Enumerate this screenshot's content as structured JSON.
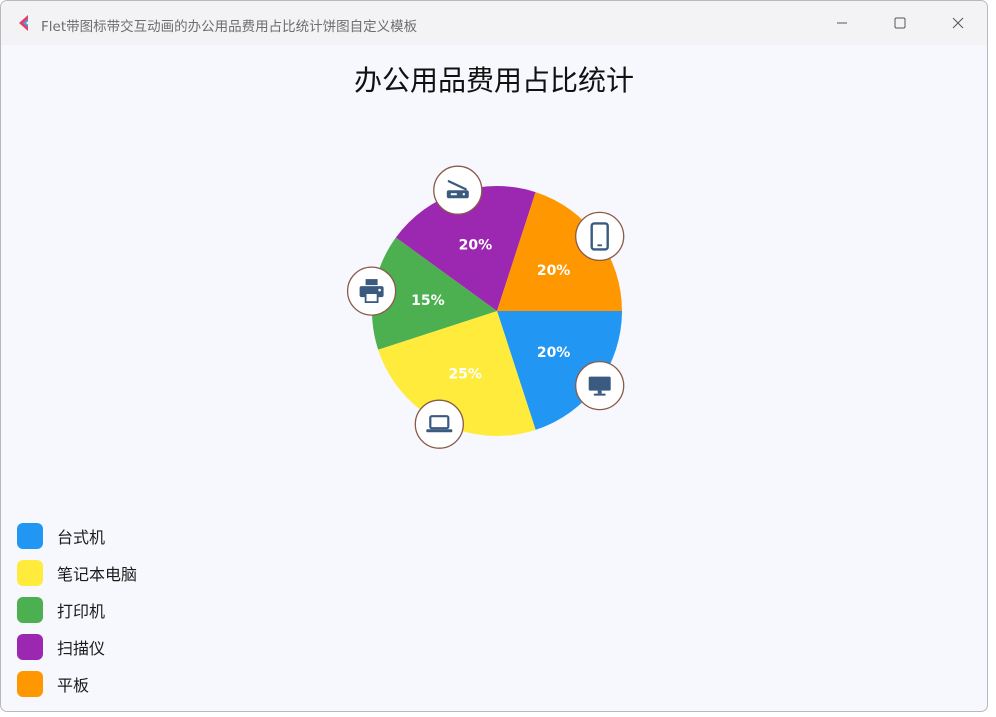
{
  "window": {
    "title": "Flet带图标带交互动画的办公用品费用占比统计饼图自定义模板"
  },
  "chart_data": {
    "type": "pie",
    "title": "办公用品费用占比统计",
    "slices": [
      {
        "name": "台式机",
        "value": 20,
        "label": "20%",
        "color": "#2196f3",
        "icon": "desktop-monitor-icon"
      },
      {
        "name": "笔记本电脑",
        "value": 25,
        "label": "25%",
        "color": "#ffeb3b",
        "icon": "laptop-icon"
      },
      {
        "name": "打印机",
        "value": 15,
        "label": "15%",
        "color": "#4caf50",
        "icon": "printer-icon"
      },
      {
        "name": "扫描仪",
        "value": 20,
        "label": "20%",
        "color": "#9c27b0",
        "icon": "scanner-icon"
      },
      {
        "name": "平板",
        "value": 20,
        "label": "20%",
        "color": "#ff9800",
        "icon": "tablet-icon"
      }
    ],
    "start_angle_deg": 0,
    "direction": "clockwise",
    "legend_position": "bottom-left"
  }
}
